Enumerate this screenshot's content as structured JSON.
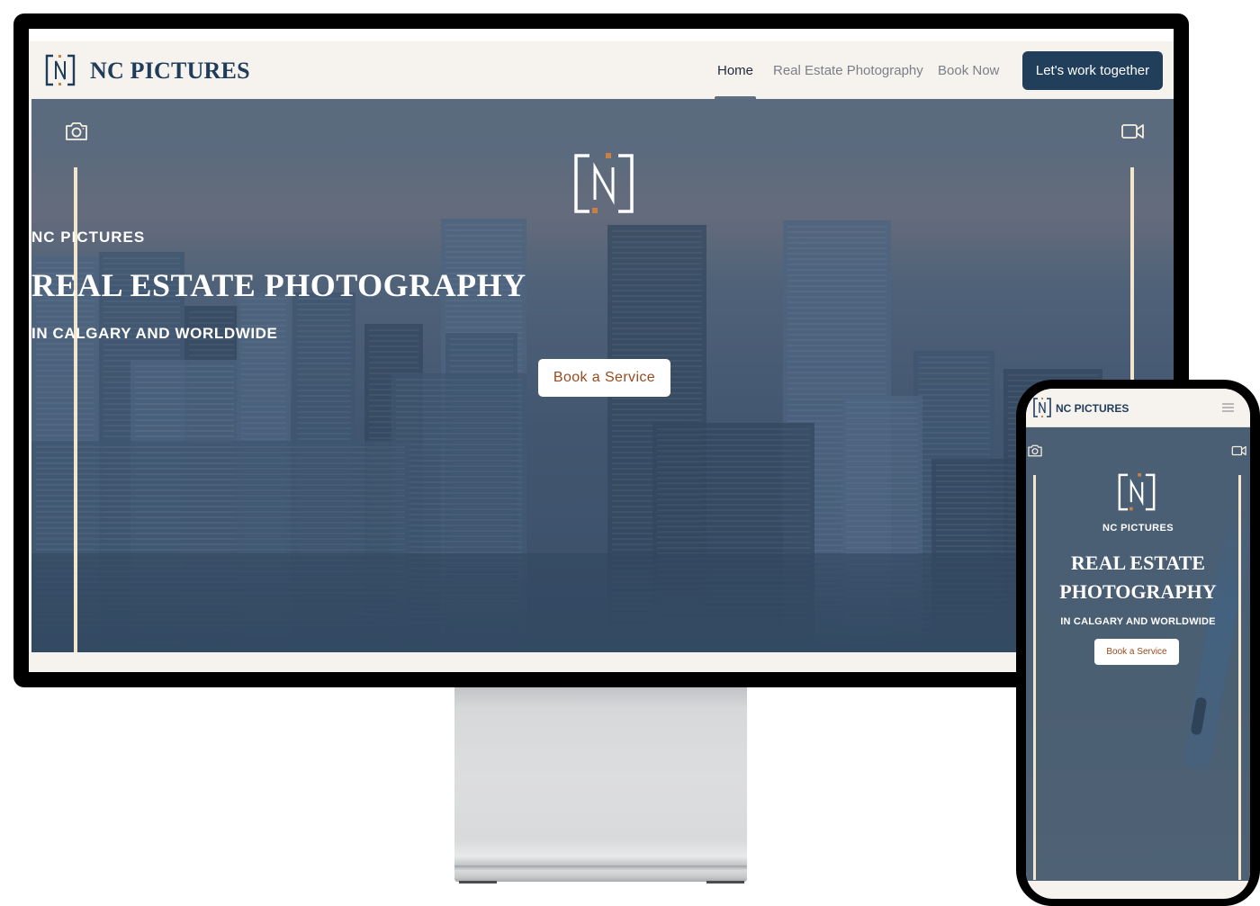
{
  "desktop": {
    "brand": "NC PICTURES",
    "nav": {
      "items": [
        {
          "label": "Home",
          "active": true
        },
        {
          "label": "Real Estate Photography",
          "active": false
        },
        {
          "label": "Book Now",
          "active": false
        }
      ],
      "cta_label": "Let's work together"
    },
    "hero": {
      "left_icon": "camera-icon",
      "right_icon": "video-camera-icon",
      "sub_brand": "NC PICTURES",
      "title": "REAL ESTATE PHOTOGRAPHY",
      "tagline": "IN CALGARY AND WORLDWIDE",
      "button_label": "Book a Service"
    }
  },
  "mobile": {
    "brand": "NC PICTURES",
    "menu_icon": "hamburger-menu-icon",
    "hero": {
      "left_icon": "camera-icon",
      "right_icon": "video-camera-icon",
      "sub_brand": "NC PICTURES",
      "title_line1": "REAL ESTATE",
      "title_line2": "PHOTOGRAPHY",
      "tagline": "IN CALGARY AND WORLDWIDE",
      "button_label": "Book a Service"
    }
  },
  "colors": {
    "brand_navy": "#1f3c5b",
    "cta_navy": "#213e5a",
    "accent_orange": "#c98044",
    "button_text": "#9a4a1e",
    "background_cream": "#f6f3ee",
    "accent_line": "#f3e6cc"
  }
}
